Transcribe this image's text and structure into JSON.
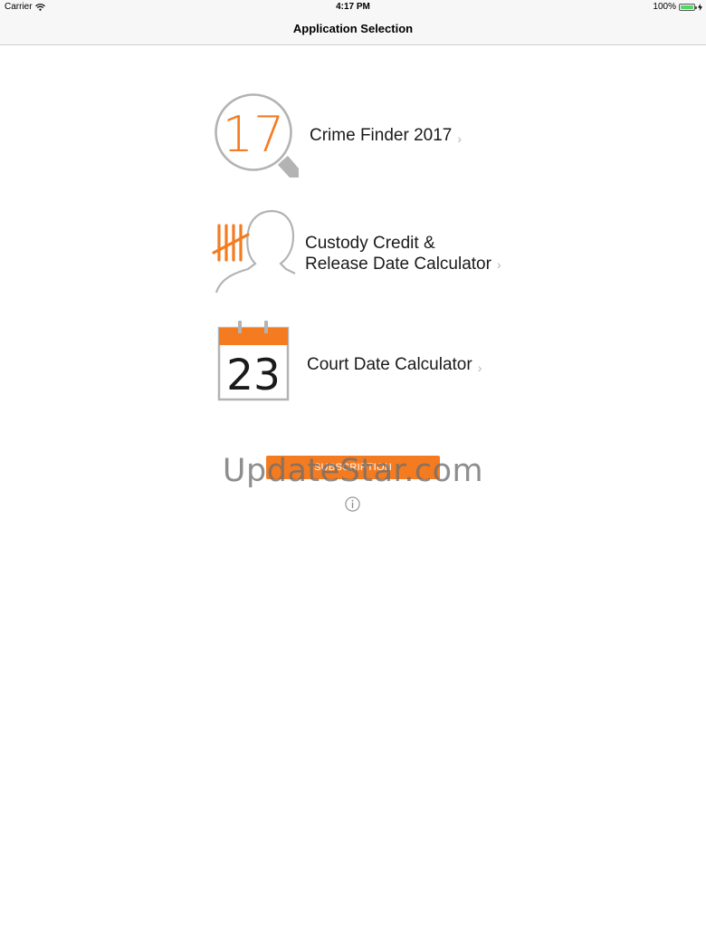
{
  "status_bar": {
    "carrier": "Carrier",
    "time": "4:17 PM",
    "battery_percent": "100%",
    "battery_level": 1.0,
    "icons": [
      "wifi-icon",
      "battery-icon",
      "charging-bolt-icon"
    ]
  },
  "nav": {
    "title": "Application Selection"
  },
  "apps": [
    {
      "icon": "magnifier-calendar-icon",
      "icon_text": "17",
      "label_line1": "Crime Finder 2017",
      "chevron": "›"
    },
    {
      "icon": "person-tally-icon",
      "label_line1": "Custody Credit &",
      "label_line2": "Release Date Calculator",
      "chevron": "›"
    },
    {
      "icon": "calendar-icon",
      "icon_text": "23",
      "label_line1": "Court Date Calculator",
      "chevron": "›"
    }
  ],
  "subscription_button": {
    "label": "SUBSCRIPTION"
  },
  "info_button": {
    "icon": "info-icon"
  },
  "watermark": "UpdateStar.com",
  "colors": {
    "accent": "#f47b20",
    "nav_background": "#f7f7f7",
    "icon_gray": "#b3b3b3",
    "chevron": "#b5b5b5",
    "text": "#1a1a1a"
  }
}
